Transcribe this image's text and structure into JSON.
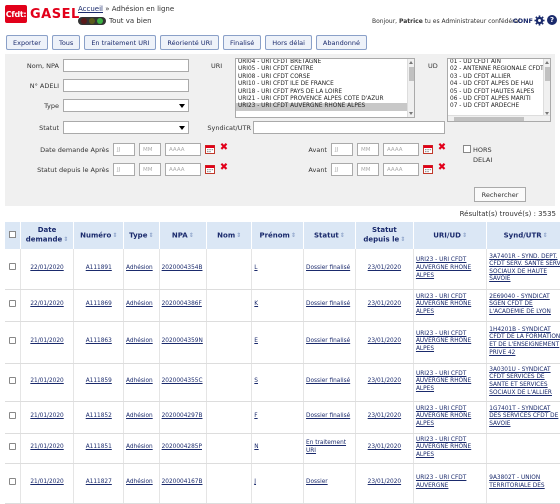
{
  "header": {
    "logo_badge": "Cfdt:",
    "logo_text": "GASEL",
    "breadcrumb_home": "Accueil",
    "breadcrumb_sep": " » ",
    "breadcrumb_current": "Adhésion en ligne",
    "status_text": "Tout va bien",
    "user_prefix": "Bonjour, ",
    "user_name": "Patrice",
    "user_suffix": " tu es Administrateur confédéral",
    "conf_label": "CONF",
    "help_label": "?"
  },
  "toolbar": {
    "buttons": [
      "Exporter",
      "Tous",
      "En traitement URI",
      "Réorienté URI",
      "Finalisé",
      "Hors délai",
      "Abandonné"
    ]
  },
  "filters": {
    "nom_npa_label": "Nom, NPA",
    "adeli_label": "N° ADELI",
    "type_label": "Type",
    "statut_label": "Statut",
    "uri_label": "URI",
    "ud_label": "UD",
    "syndicat_label": "Syndicat/UTR",
    "date_demande_label": "Date demande Après",
    "statut_depuis_label": "Statut depuis le Après",
    "avant_label": "Avant",
    "hors_delai_label": "HORS DELAI",
    "day_ph": "JJ",
    "month_ph": "MM",
    "year_ph": "AAAA",
    "search_label": "Rechercher",
    "uri_options": [
      "URI04 - URI CFDT BRETAGNE",
      "URI05 - URI CFDT CENTRE",
      "URI08 - URI CFDT CORSE",
      "URI10 - URI CFDT ILE DE FRANCE",
      "URI18 - URI CFDT PAYS DE LA LOIRE",
      "URI21 - URI CFDT PROVENCE ALPES COTE D'AZUR",
      "URI23 - URI CFDT AUVERGNE RHONE ALPES"
    ],
    "ud_options": [
      "01 - UD CFDT AIN",
      "02 - ANTENNE REGIONALE CFDT",
      "03 - UD CFDT ALLIER",
      "04 - UD CFDT ALPES DE HAU",
      "05 - UD CFDT HAUTES ALPES",
      "06 - UD CFDT ALPES MARITI",
      "07 - UD CFDT ARDECHE"
    ]
  },
  "results": {
    "label": "Résultat(s) trouvé(s) :",
    "count": "3535"
  },
  "table": {
    "headers": [
      "Date demande",
      "Numéro",
      "Type",
      "NPA",
      "Nom",
      "Prénom",
      "Statut",
      "Statut depuis le",
      "URI/UD",
      "Synd/UTR"
    ],
    "rows": [
      {
        "date": "22/01/2020",
        "numero": "A111891",
        "type": "Adhésion",
        "npa": "2020004354B",
        "nom": "",
        "prenom": "L",
        "statut": "Dossier finalisé",
        "depuis": "23/01/2020",
        "uri": "URI23 - URI CFDT AUVERGNE RHONE ALPES",
        "synd": "3A7401R - SYND. DEPT. CFDT SERV. SANTE SERV. SOCIAUX DE HAUTE SAVOIE"
      },
      {
        "date": "22/01/2020",
        "numero": "A111869",
        "type": "Adhésion",
        "npa": "2020004386F",
        "nom": "",
        "prenom": "K",
        "statut": "Dossier finalisé",
        "depuis": "23/01/2020",
        "uri": "URI23 - URI CFDT AUVERGNE RHONE ALPES",
        "synd": "2E69040 - SYNDICAT SGEN CFDT DE L'ACADEMIE DE LYON"
      },
      {
        "date": "21/01/2020",
        "numero": "A111863",
        "type": "Adhésion",
        "npa": "2020004359N",
        "nom": "",
        "prenom": "E",
        "statut": "Dossier finalisé",
        "depuis": "23/01/2020",
        "uri": "URI23 - URI CFDT AUVERGNE RHONE ALPES",
        "synd": "1H4201B - SYNDICAT CFDT DE LA FORMATION ET DE L'ENSEIGNEMENT PRIVE 42"
      },
      {
        "date": "21/01/2020",
        "numero": "A111859",
        "type": "Adhésion",
        "npa": "2020004355C",
        "nom": "",
        "prenom": "S",
        "statut": "Dossier finalisé",
        "depuis": "23/01/2020",
        "uri": "URI23 - URI CFDT AUVERGNE RHONE ALPES",
        "synd": "3A0301U - SYNDICAT CFDT SERVICES DE SANTE ET SERVICES SOCIAUX DE L'ALLIER"
      },
      {
        "date": "21/01/2020",
        "numero": "A111852",
        "type": "Adhésion",
        "npa": "2020004297B",
        "nom": "",
        "prenom": "F",
        "statut": "Dossier finalisé",
        "depuis": "23/01/2020",
        "uri": "URI23 - URI CFDT AUVERGNE RHONE ALPES",
        "synd": "1G7401T - SYNDICAT DES SERVICES CFDT DE SAVOIE"
      },
      {
        "date": "21/01/2020",
        "numero": "A111851",
        "type": "Adhésion",
        "npa": "2020004285P",
        "nom": "",
        "prenom": "N",
        "statut": "En traitement URI",
        "depuis": "23/01/2020",
        "uri": "URI23 - URI CFDT AUVERGNE RHONE ALPES",
        "synd": ""
      },
      {
        "date": "21/01/2020",
        "numero": "A111827",
        "type": "Adhésion",
        "npa": "2020004167B",
        "nom": "",
        "prenom": "J",
        "statut": "Dossier",
        "depuis": "23/01/2020",
        "uri": "URI23 - URI CFDT AUVERGNE",
        "synd": "9A3802T - UNION TERRITORIALE DES"
      }
    ]
  },
  "colors": {
    "brand_red": "#e2001a",
    "nav_blue": "#1a2a6c",
    "header_bg": "#dbe7f5",
    "filter_bg": "#f0f0f0",
    "status_dot_1": "#e2001a",
    "status_dot_2": "#f2b705",
    "status_dot_3": "#3cb043"
  }
}
